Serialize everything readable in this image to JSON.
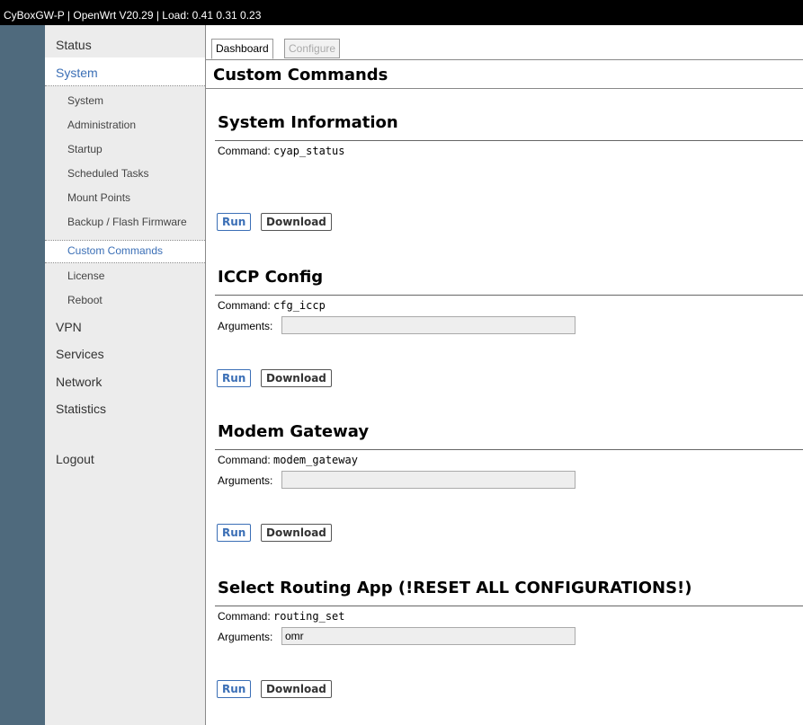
{
  "window": {
    "title": "CyBoxGW-P | OpenWrt V20.29 | Load: 0.41 0.31 0.23"
  },
  "sidebar": {
    "status": "Status",
    "system": "System",
    "system_items": [
      "System",
      "Administration",
      "Startup",
      "Scheduled Tasks",
      "Mount Points",
      "Backup / Flash Firmware",
      "Custom Commands",
      "License",
      "Reboot"
    ],
    "vpn": "VPN",
    "services": "Services",
    "network": "Network",
    "statistics": "Statistics",
    "logout": "Logout"
  },
  "tabs": {
    "dashboard": "Dashboard",
    "configure": "Configure"
  },
  "page": {
    "title": "Custom Commands"
  },
  "commands": [
    {
      "title": "System Information",
      "command_label": "Command:",
      "command": "cyap_status",
      "run": "Run",
      "download": "Download"
    },
    {
      "title": "ICCP Config",
      "command_label": "Command:",
      "command": "cfg_iccp",
      "args_label": "Arguments:",
      "args_value": "",
      "run": "Run",
      "download": "Download"
    },
    {
      "title": "Modem Gateway",
      "command_label": "Command:",
      "command": "modem_gateway",
      "args_label": "Arguments:",
      "args_value": "",
      "run": "Run",
      "download": "Download"
    },
    {
      "title": "Select Routing App (!RESET ALL CONFIGURATIONS!)",
      "command_label": "Command:",
      "command": "routing_set",
      "args_label": "Arguments:",
      "args_value": "omr",
      "run": "Run",
      "download": "Download"
    }
  ],
  "colors": {
    "accent": "#3b6fb6",
    "sidebar_strip": "#4f6a7d",
    "sidebar_bg": "#ececec"
  }
}
